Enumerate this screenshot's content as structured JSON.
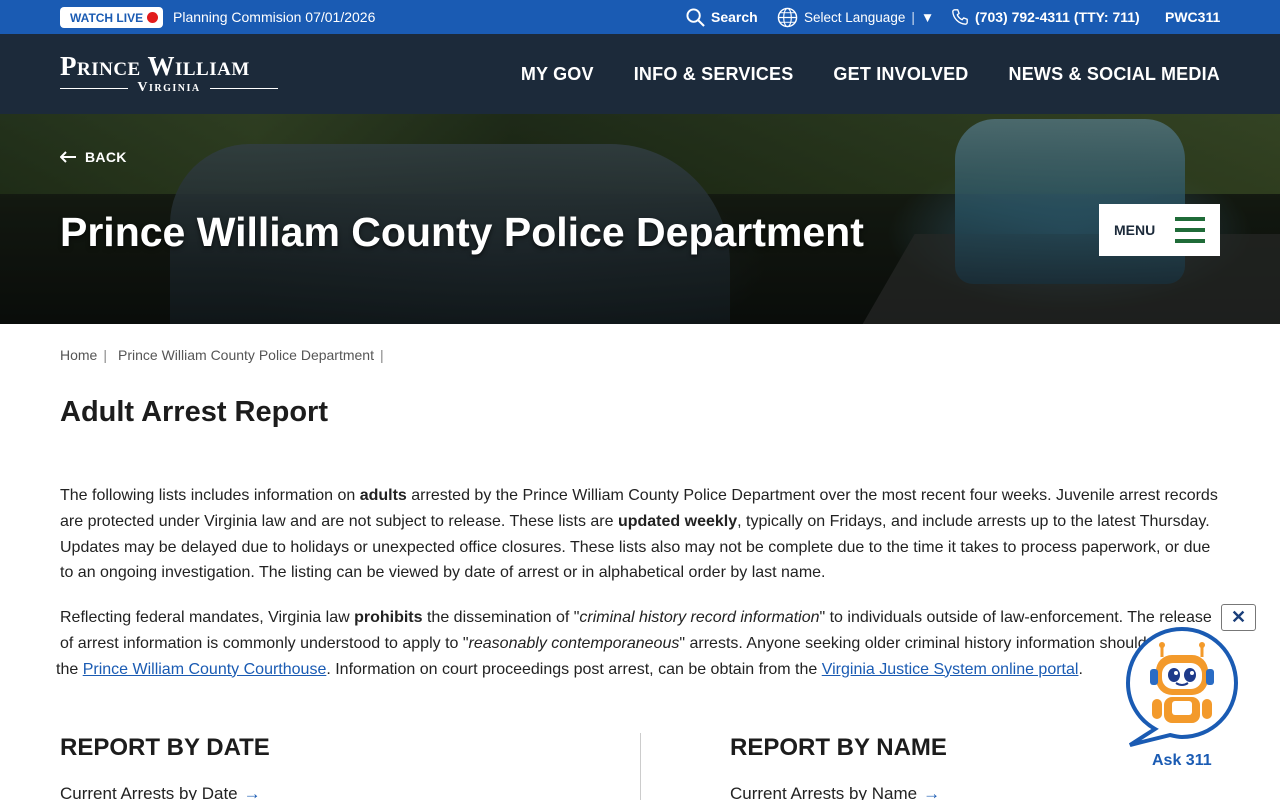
{
  "topbar": {
    "watch_live": "WATCH LIVE",
    "event": "Planning Commision 07/01/2026",
    "search": "Search",
    "language": "Select Language",
    "language_sep": "|",
    "language_caret": "▼",
    "phone": "(703) 792-4311 (TTY: 711)",
    "pwc311": "PWC311",
    "colors": {
      "bar": "#1a5bb3",
      "live_dot": "#e21b1b"
    }
  },
  "logo": {
    "line1": "Prince William",
    "line2": "Virginia"
  },
  "nav": {
    "items": [
      "MY GOV",
      "INFO & SERVICES",
      "GET INVOLVED",
      "NEWS & SOCIAL MEDIA"
    ]
  },
  "hero": {
    "back": "BACK",
    "title": "Prince William County Police Department",
    "menu": "MENU"
  },
  "breadcrumb": {
    "items": [
      "Home",
      "Prince William County Police Department"
    ],
    "sep": "|"
  },
  "page": {
    "title": "Adult Arrest Report",
    "p1": {
      "a": "The following lists includes information on ",
      "b": "adults",
      "c": " arrested by the Prince William County Police Department over the most recent four weeks. Juvenile arrest records are protected under Virginia law and are not subject to release. These lists are ",
      "d": "updated weekly",
      "e": ", typically on Fridays, and include arrests up to the latest Thursday. Updates may be delayed due to holidays or unexpected office closures. These lists also may not be complete due to the time it takes to process paperwork, or due to an ongoing investigation. The listing can be viewed by date of arrest or in alphabetical order by last name."
    },
    "p2": {
      "a": "Reflecting federal mandates, Virginia law ",
      "b": "prohibits",
      "c": " the dissemination of \"",
      "d": "criminal history record information",
      "e": "\" to individuals outside of law-enforcement. The release of arrest information is commonly understood to apply to \"",
      "f": "reasonably contemporaneous",
      "g": "\" arrests. Anyone seeking older criminal history information should",
      "h": " the ",
      "link1": "Prince William County Courthouse",
      "i": ". Information on court proceedings post arrest, can be obtain from the ",
      "link2": "Virginia Justice System online portal",
      "j": "."
    }
  },
  "report_by_date": {
    "title": "REPORT BY DATE",
    "link": "Current Arrests by Date",
    "arrow": "→"
  },
  "report_by_name": {
    "title": "REPORT BY NAME",
    "link": "Current Arrests by Name",
    "arrow": "→"
  },
  "chat": {
    "close": "✕",
    "label": "Ask 311"
  }
}
